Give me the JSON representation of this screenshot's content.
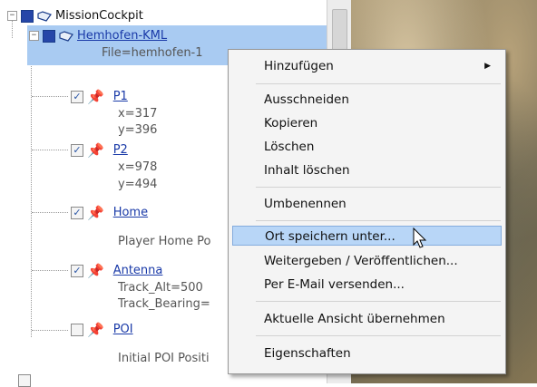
{
  "tree": {
    "root": {
      "label": "MissionCockpit"
    },
    "kml": {
      "label": "Hemhofen-KML",
      "file": "File=hemhofen-1"
    },
    "p1": {
      "label": "P1",
      "x": "x=317",
      "y": "y=396"
    },
    "p2": {
      "label": "P2",
      "x": "x=978",
      "y": "y=494"
    },
    "home": {
      "label": "Home",
      "desc": "Player Home Po"
    },
    "antenna": {
      "label": "Antenna",
      "alt": "Track_Alt=500",
      "bearing": "Track_Bearing="
    },
    "poi": {
      "label": "POI",
      "desc": "Initial POI Positi"
    }
  },
  "menu": {
    "add": "Hinzufügen",
    "cut": "Ausschneiden",
    "copy": "Kopieren",
    "delete": "Löschen",
    "clear": "Inhalt löschen",
    "rename": "Umbenennen",
    "save_place": "Ort speichern unter...",
    "share": "Weitergeben / Veröffentlichen...",
    "email": "Per E-Mail versenden...",
    "apply_view": "Aktuelle Ansicht übernehmen",
    "properties": "Eigenschaften"
  },
  "colors": {
    "selection": "#a9cbf2",
    "link": "#1a3aa8",
    "menu_highlight": "#b8d6f7"
  },
  "icons": {
    "pin": "pushpin-icon",
    "kml": "kml-layer-icon"
  }
}
